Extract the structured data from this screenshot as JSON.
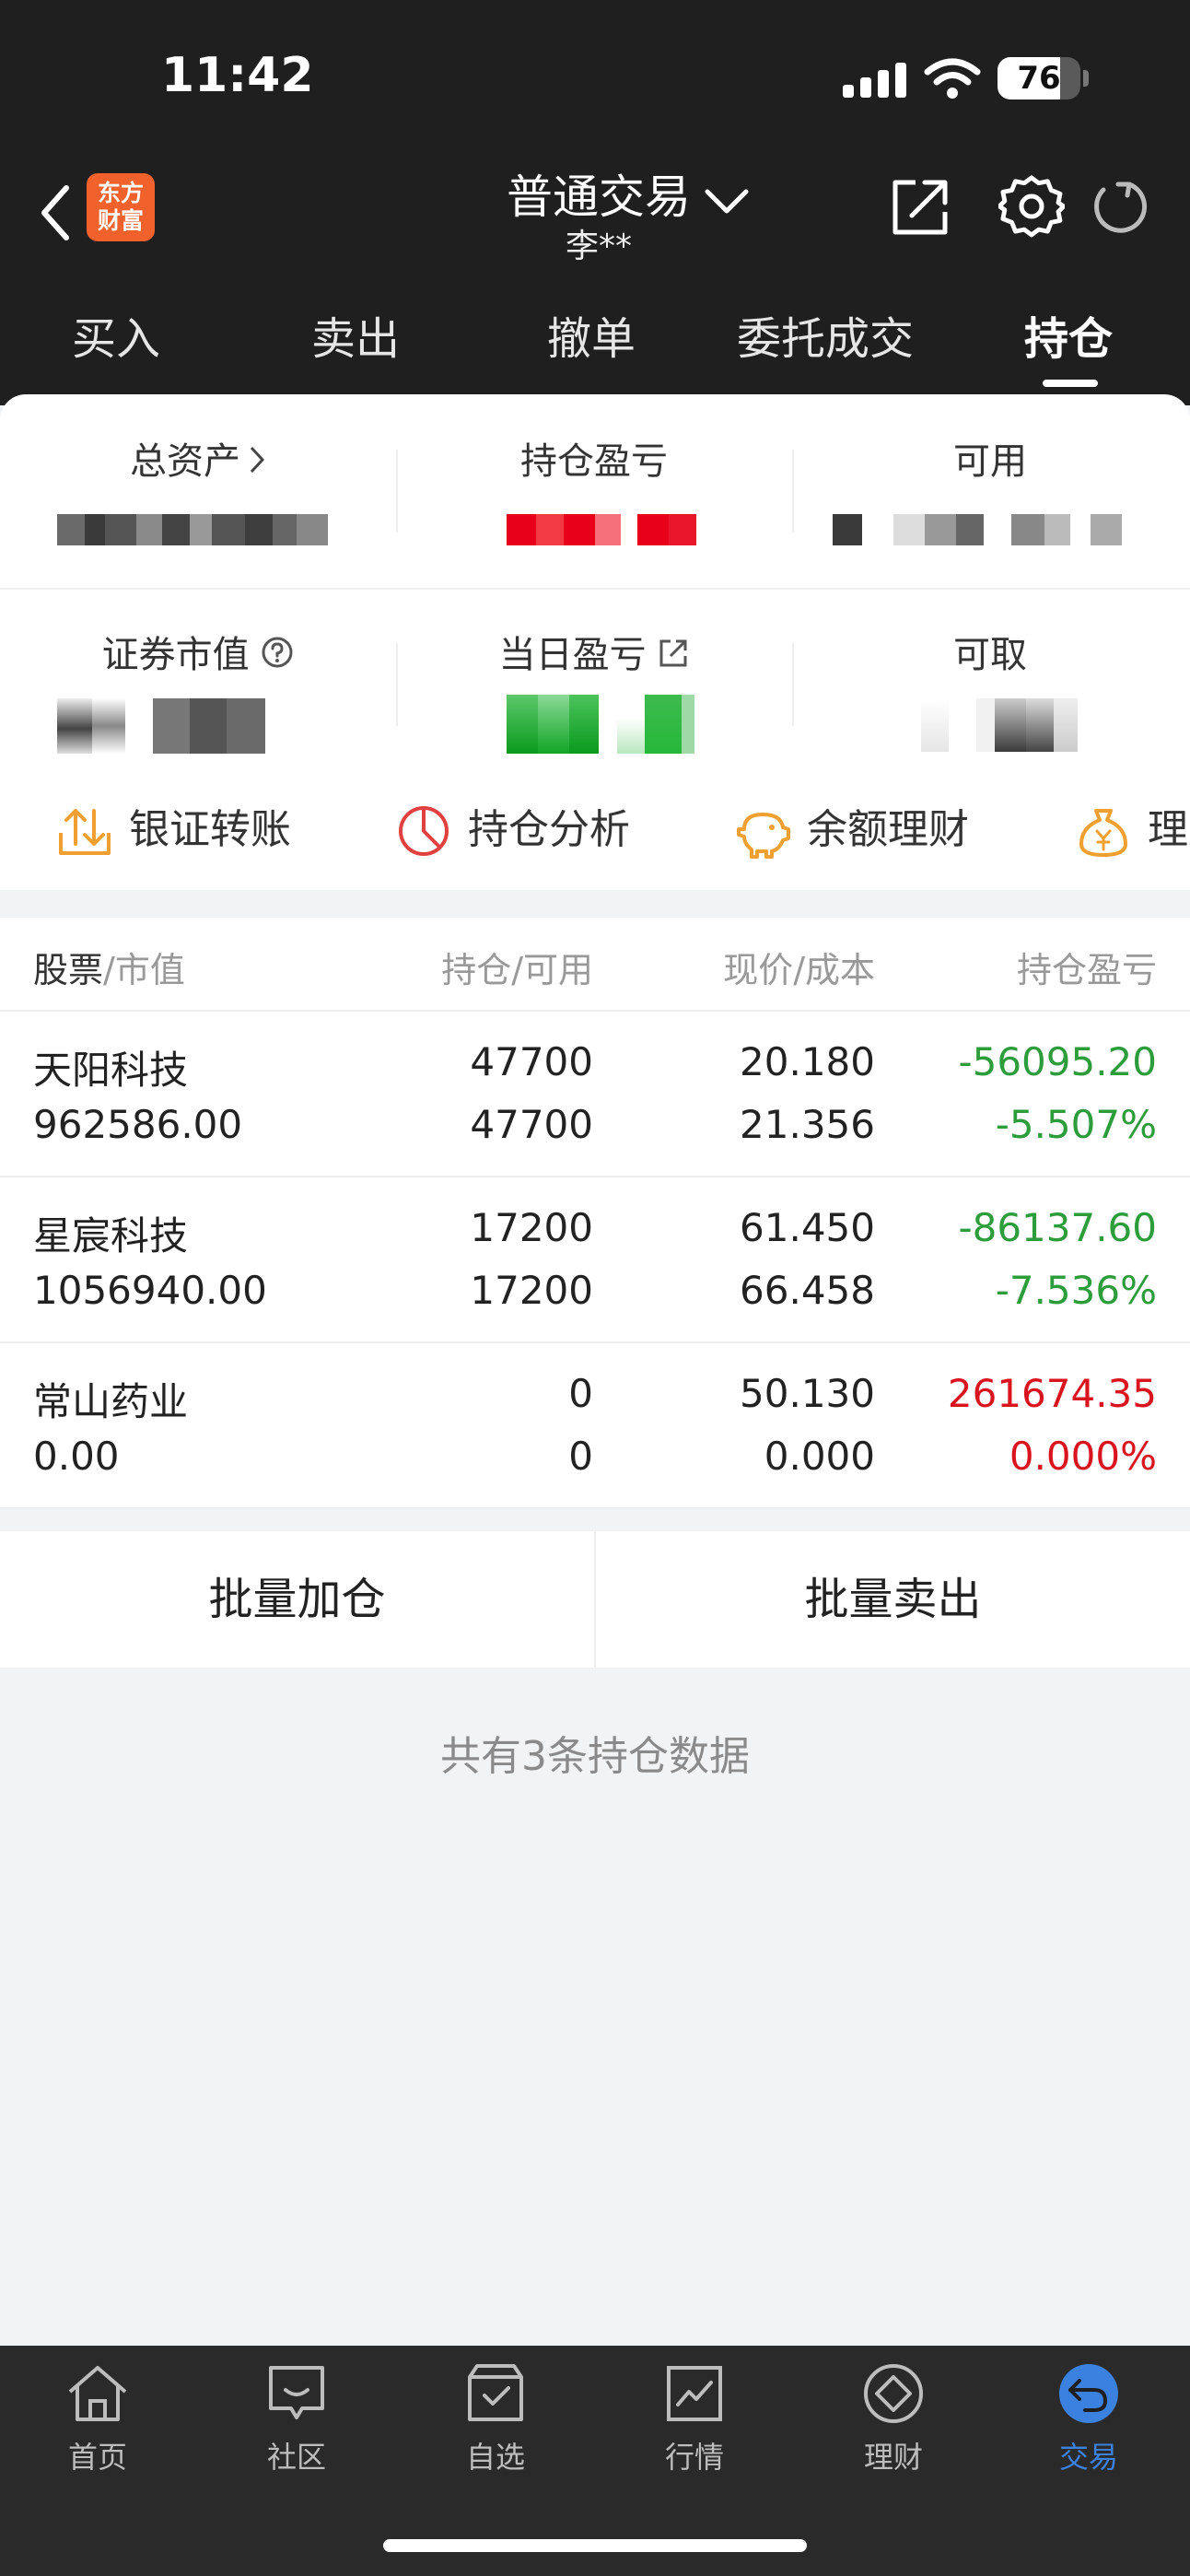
{
  "status": {
    "time": "11:42",
    "battery": "76",
    "battery_level": 0.76
  },
  "nav": {
    "logo_line1": "东方",
    "logo_line2": "财富",
    "title": "普通交易",
    "subtitle": "李**"
  },
  "tabs": [
    {
      "label": "买入"
    },
    {
      "label": "卖出"
    },
    {
      "label": "撤单"
    },
    {
      "label": "委托成交"
    },
    {
      "label": "持仓",
      "active": true
    }
  ],
  "summary": {
    "total_assets": "总资产",
    "position_pnl": "持仓盈亏",
    "available": "可用",
    "market_value": "证券市值",
    "daily_pnl": "当日盈亏",
    "withdrawable": "可取"
  },
  "quick_actions": [
    {
      "label": "银证转账",
      "icon": "transfer-icon"
    },
    {
      "label": "持仓分析",
      "icon": "pie-chart-icon"
    },
    {
      "label": "余额理财",
      "icon": "piggy-bank-icon"
    },
    {
      "label": "理财",
      "icon": "money-bag-icon"
    }
  ],
  "table": {
    "headers": {
      "stock": "股票",
      "market_value": "/市值",
      "position_available": "持仓/可用",
      "price_cost": "现价/成本",
      "pnl": "持仓盈亏"
    },
    "rows": [
      {
        "name": "天阳科技",
        "market_value": "962586.00",
        "position": "47700",
        "available": "47700",
        "price": "20.180",
        "cost": "21.356",
        "pnl": "-56095.20",
        "pnl_pct": "-5.507%",
        "trend": "down"
      },
      {
        "name": "星宸科技",
        "market_value": "1056940.00",
        "position": "17200",
        "available": "17200",
        "price": "61.450",
        "cost": "66.458",
        "pnl": "-86137.60",
        "pnl_pct": "-7.536%",
        "trend": "down"
      },
      {
        "name": "常山药业",
        "market_value": "0.00",
        "position": "0",
        "available": "0",
        "price": "50.130",
        "cost": "0.000",
        "pnl": "261674.35",
        "pnl_pct": "0.000%",
        "trend": "up"
      }
    ]
  },
  "batch": {
    "add": "批量加仓",
    "sell": "批量卖出"
  },
  "count_text": "共有3条持仓数据",
  "bottom_tabs": [
    {
      "label": "首页",
      "icon": "home-icon"
    },
    {
      "label": "社区",
      "icon": "community-icon"
    },
    {
      "label": "自选",
      "icon": "watchlist-icon"
    },
    {
      "label": "行情",
      "icon": "market-icon"
    },
    {
      "label": "理财",
      "icon": "wealth-icon"
    },
    {
      "label": "交易",
      "icon": "trade-icon",
      "active": true
    }
  ],
  "colors": {
    "down": "#2d9c3a",
    "up": "#d9141e",
    "accent": "#3b82e0",
    "brand": "#f1612c"
  }
}
